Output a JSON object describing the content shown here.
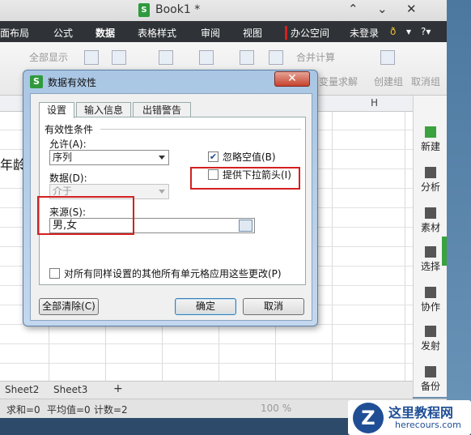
{
  "window": {
    "title": "Book1 *",
    "minimize_glyph": "⌃",
    "restore_glyph": "⌄",
    "close_glyph": "✕"
  },
  "menu": {
    "items": [
      "面布局",
      "公式",
      "数据",
      "表格样式",
      "审阅",
      "视图",
      "办公空间",
      "未登录"
    ],
    "active": "数据"
  },
  "ribbon": {
    "labels": [
      "全部显示",
      "合并计算",
      "变量求解",
      "创建组",
      "取消组"
    ]
  },
  "sheet": {
    "column_header": "H",
    "cell_text": "年龄",
    "tabs": [
      "Sheet2",
      "Sheet3"
    ],
    "add_tab": "+"
  },
  "side_panel": {
    "items": [
      "新建",
      "分析",
      "素材",
      "选择",
      "协作",
      "发射",
      "备份"
    ]
  },
  "status_bar": {
    "sum": "求和=0",
    "avg": "平均值=0",
    "count": "计数=2",
    "zoom": "100 %"
  },
  "dialog": {
    "title": "数据有效性",
    "close": "✕",
    "tabs": [
      "设置",
      "输入信息",
      "出错警告"
    ],
    "active_tab": "设置",
    "group_title": "有效性条件",
    "allow_label": "允许(A):",
    "allow_value": "序列",
    "data_label": "数据(D):",
    "data_value": "介于",
    "ignore_blank_label": "忽略空值(B)",
    "ignore_blank_checked": true,
    "dropdown_label": "提供下拉箭头(I)",
    "dropdown_checked": false,
    "source_label": "来源(S):",
    "source_value": "男,女",
    "apply_all_label": "对所有同样设置的其他所有单元格应用这些更改(P)",
    "apply_all_checked": false,
    "clear_button": "全部清除(C)",
    "ok_button": "确定",
    "cancel_button": "取消"
  },
  "watermark": {
    "logo_letter": "Z",
    "name_cn": "这里教程网",
    "name_en": "herecours.com"
  },
  "colors": {
    "menu_bg": "#2f3236",
    "highlight": "#d42020",
    "brand_green": "#2e9a3e"
  }
}
